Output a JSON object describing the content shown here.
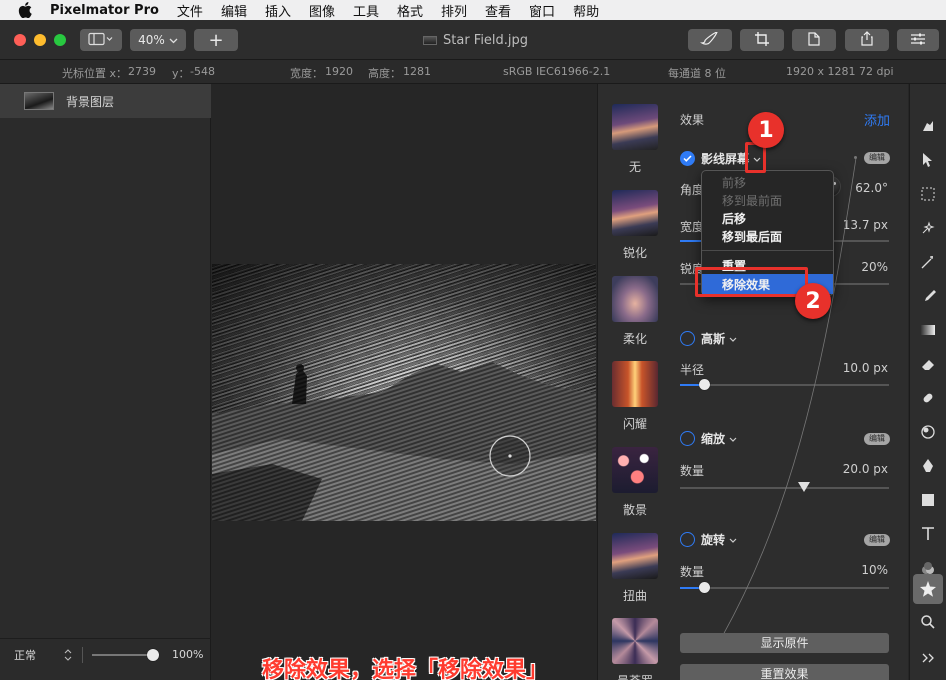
{
  "menubar": {
    "app_name": "Pixelmator Pro",
    "items": [
      "文件",
      "编辑",
      "插入",
      "图像",
      "工具",
      "格式",
      "排列",
      "查看",
      "窗口",
      "帮助"
    ]
  },
  "toolbar": {
    "zoom": "40%",
    "add_label": "+",
    "document_title": "Star Field.jpg"
  },
  "infobar": {
    "cursor_x_label": "光标位置 x：",
    "cursor_x": "2739",
    "cursor_y_label": "y：",
    "cursor_y": "-548",
    "width_label": "宽度：",
    "width": "1920",
    "height_label": "高度：",
    "height": "1281",
    "color_profile": "sRGB IEC61966-2.1",
    "bit_depth": "每通道 8 位",
    "dimensions": "1920 x 1281 72 dpi"
  },
  "layers": {
    "items": [
      {
        "name": "背景图层"
      }
    ],
    "blend_mode": "正常",
    "opacity": "100%",
    "opacity_level": 1.0
  },
  "effects": {
    "header": "效果",
    "add_label": "添加",
    "edit_label": "编辑",
    "presets": [
      {
        "label": "无"
      },
      {
        "label": "锐化"
      },
      {
        "label": "柔化"
      },
      {
        "label": "闪耀"
      },
      {
        "label": "散景"
      },
      {
        "label": "扭曲"
      },
      {
        "label": "曼荼罗"
      }
    ],
    "screen": {
      "name": "影线屏幕",
      "angle_label": "角度",
      "angle_value": "62.0°",
      "width_label": "宽度",
      "width_value": "13.7 px",
      "sharpness_label": "锐度",
      "sharpness_value": "20%"
    },
    "gaussian": {
      "name": "高斯",
      "radius_label": "半径",
      "radius_value": "10.0 px",
      "radius_level": 0.12
    },
    "zoom": {
      "name": "缩放",
      "amount_label": "数量",
      "amount_value": "20.0 px",
      "amount_level": 0.59
    },
    "spin": {
      "name": "旋转",
      "amount_label": "数量",
      "amount_value": "10%",
      "amount_level": 0.12
    },
    "show_original": "显示原件",
    "reset_effects": "重置效果"
  },
  "context_menu": {
    "items": [
      "前移",
      "移到最前面",
      "后移",
      "移到最后面",
      "重置",
      "移除效果"
    ],
    "highlighted": "移除效果"
  },
  "annotations": {
    "step1": "1",
    "step2": "2",
    "caption": "移除效果，选择「移除效果」"
  },
  "colors": {
    "accent": "#2f7bf5",
    "annotation_red": "#e8312b",
    "menu_highlight": "#2f6ad8"
  }
}
